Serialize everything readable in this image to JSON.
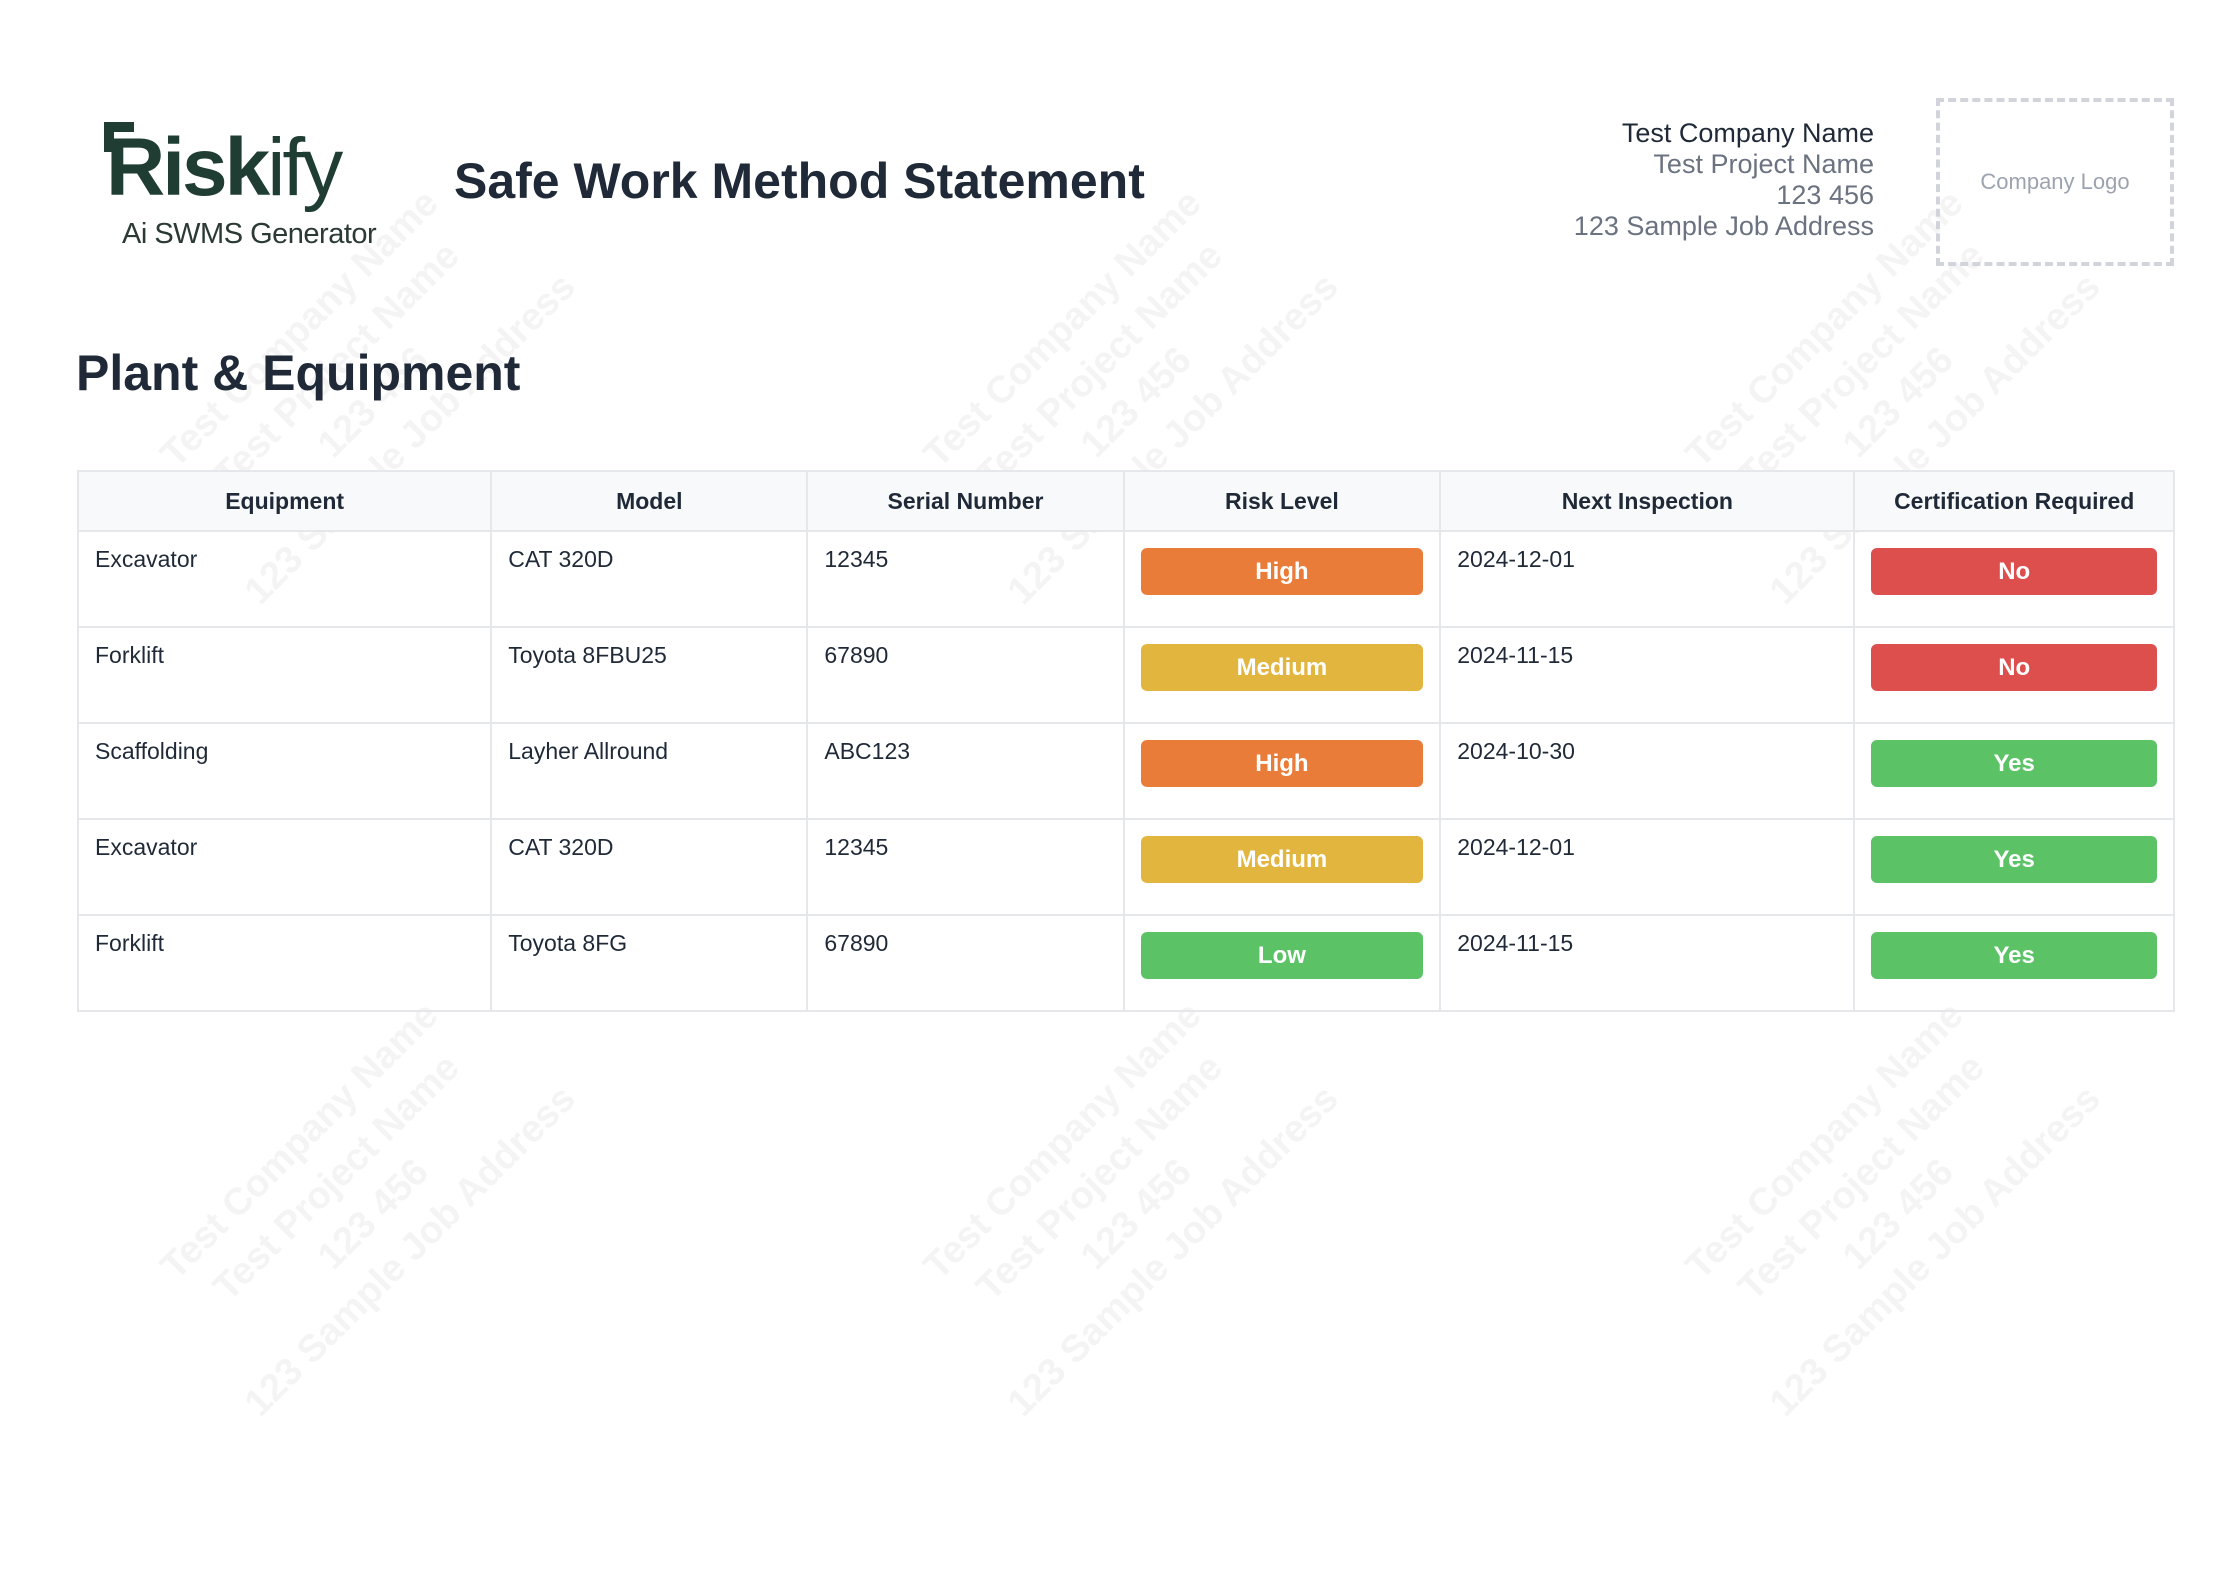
{
  "watermark": {
    "lines": [
      "Test Company Name",
      "Test Project Name",
      "123 456",
      "123 Sample Job Address"
    ]
  },
  "logo": {
    "word_bold": "Risk",
    "word_light": "ify",
    "subtitle": "Ai SWMS Generator",
    "color": "#1f3d32"
  },
  "header": {
    "document_title": "Safe Work Method Statement",
    "company_name": "Test Company Name",
    "project_name": "Test Project Name",
    "project_number": "123 456",
    "job_address": "123 Sample Job Address",
    "logo_placeholder": "Company Logo"
  },
  "section": {
    "title": "Plant & Equipment"
  },
  "table": {
    "headers": [
      "Equipment",
      "Model",
      "Serial Number",
      "Risk Level",
      "Next Inspection",
      "Certification Required"
    ],
    "rows": [
      {
        "equipment": "Excavator",
        "model": "CAT 320D",
        "serial": "12345",
        "risk": "High",
        "inspection": "2024-12-01",
        "certification": "No"
      },
      {
        "equipment": "Forklift",
        "model": "Toyota 8FBU25",
        "serial": "67890",
        "risk": "Medium",
        "inspection": "2024-11-15",
        "certification": "No"
      },
      {
        "equipment": "Scaffolding",
        "model": "Layher Allround",
        "serial": "ABC123",
        "risk": "High",
        "inspection": "2024-10-30",
        "certification": "Yes"
      },
      {
        "equipment": "Excavator",
        "model": "CAT 320D",
        "serial": "12345",
        "risk": "Medium",
        "inspection": "2024-12-01",
        "certification": "Yes"
      },
      {
        "equipment": "Forklift",
        "model": "Toyota 8FG",
        "serial": "67890",
        "risk": "Low",
        "inspection": "2024-11-15",
        "certification": "Yes"
      }
    ]
  },
  "colors": {
    "risk_high": "#e97c38",
    "risk_medium": "#e2b53e",
    "risk_low": "#5bc266",
    "cert_no": "#dd4f4c",
    "cert_yes": "#5bc266"
  }
}
